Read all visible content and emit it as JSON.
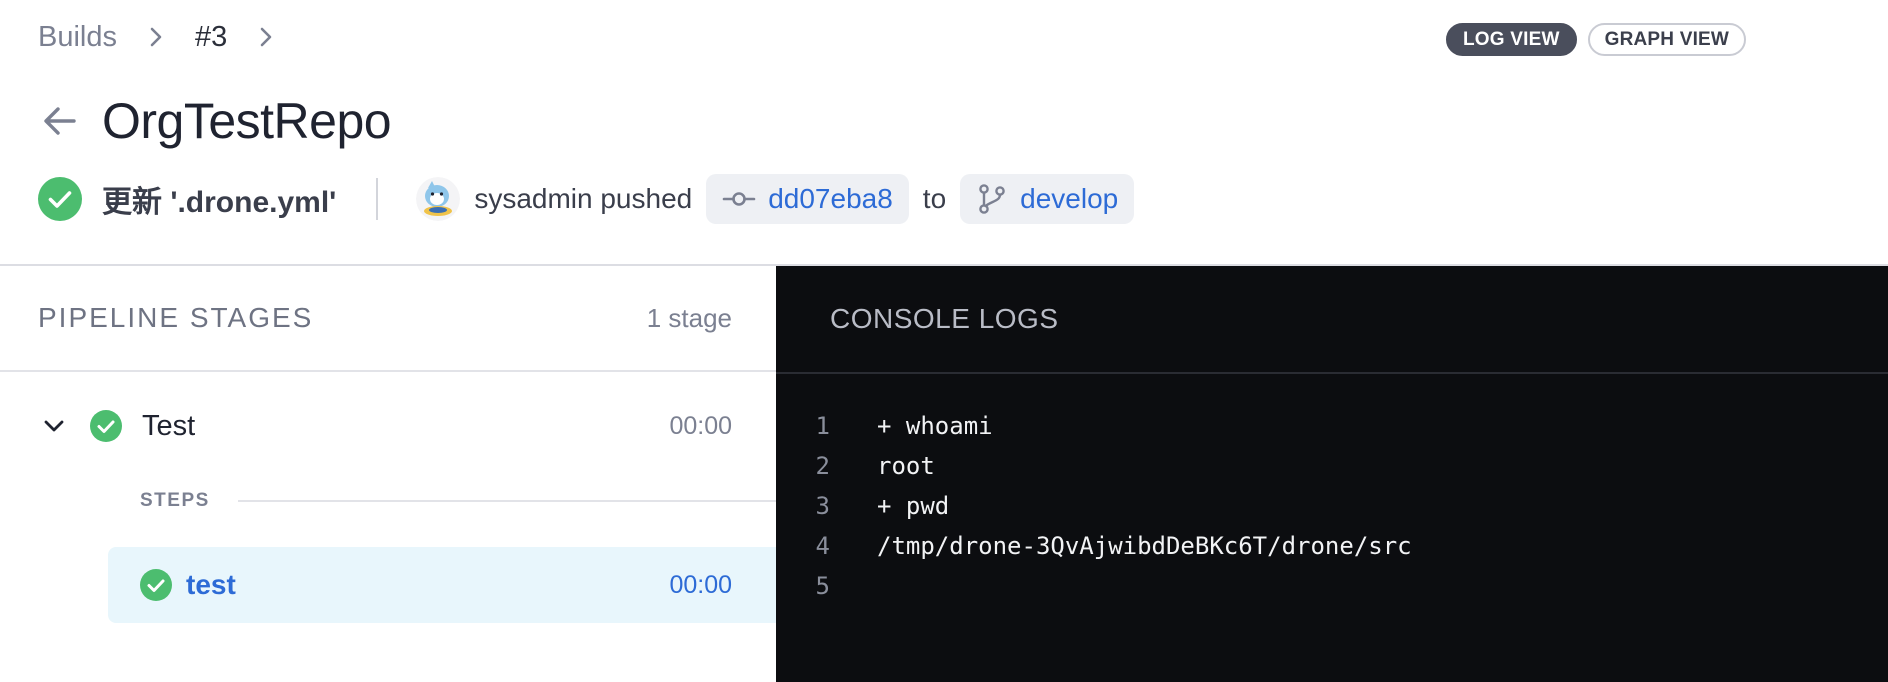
{
  "breadcrumb": {
    "builds": "Builds",
    "build_number": "#3"
  },
  "view_toggle": {
    "log_view": "LOG VIEW",
    "graph_view": "GRAPH VIEW"
  },
  "repo": {
    "name": "OrgTestRepo"
  },
  "commit": {
    "message": "更新 '.drone.yml'",
    "author_action": "sysadmin pushed",
    "sha": "dd07eba8",
    "to_label": "to",
    "branch": "develop",
    "status": "success"
  },
  "pipeline": {
    "title": "PIPELINE STAGES",
    "stage_count": "1 stage",
    "stages": [
      {
        "name": "Test",
        "duration": "00:00",
        "status": "success",
        "steps_label": "STEPS",
        "steps": [
          {
            "name": "test",
            "duration": "00:00",
            "status": "success"
          }
        ]
      }
    ]
  },
  "console": {
    "title": "CONSOLE LOGS",
    "lines": [
      {
        "num": "1",
        "text": "+ whoami"
      },
      {
        "num": "2",
        "text": "root"
      },
      {
        "num": "3",
        "text": "+ pwd"
      },
      {
        "num": "4",
        "text": "/tmp/drone-3QvAjwibdDeBKc6T/drone/src"
      },
      {
        "num": "5",
        "text": ""
      }
    ]
  },
  "colors": {
    "success": "#4cbd6f",
    "link": "#2d6bd6",
    "console_bg": "#0c0d10"
  }
}
